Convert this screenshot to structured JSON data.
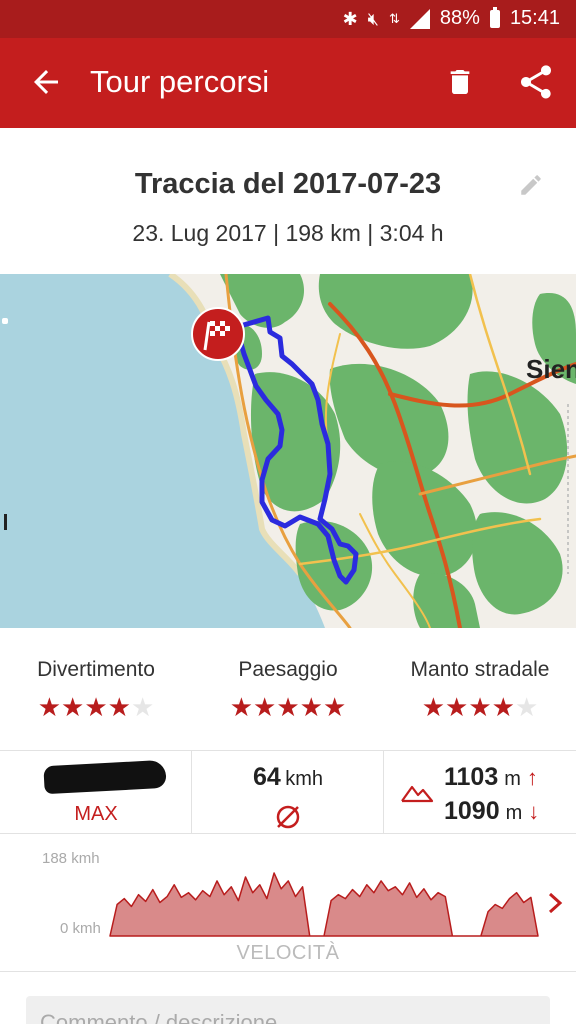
{
  "status_bar": {
    "battery": "88%",
    "time": "15:41",
    "icons": [
      "bluetooth-icon",
      "mute-icon",
      "data-icon",
      "signal-icon",
      "battery-icon"
    ]
  },
  "app_bar": {
    "title": "Tour percorsi",
    "icons": [
      "back-arrow-icon",
      "trash-icon",
      "share-icon"
    ]
  },
  "track": {
    "name": "Traccia del 2017-07-23",
    "summary": "23. Lug 2017 | 198 km | 3:04 h"
  },
  "map": {
    "city_label": "Sien"
  },
  "ratings": [
    {
      "label": "Divertimento",
      "stars": 4,
      "max": 5
    },
    {
      "label": "Paesaggio",
      "stars": 5,
      "max": 5
    },
    {
      "label": "Manto stradale",
      "stars": 4,
      "max": 5
    }
  ],
  "stats": {
    "max_label": "MAX",
    "avg_value": "64",
    "avg_unit": "kmh",
    "ascent_value": "1103",
    "descent_value": "1090",
    "elevation_unit": "m",
    "up_arrow": "↑",
    "down_arrow": "↓"
  },
  "speed_chart": {
    "y_max_label": "188 kmh",
    "y_min_label": "0 kmh",
    "x_label": "VELOCITÀ"
  },
  "chart_data": {
    "type": "area",
    "ylim": [
      0,
      188
    ],
    "series": [
      {
        "values": [
          0,
          80,
          95,
          75,
          105,
          88,
          118,
          85,
          100,
          130,
          98,
          110,
          92,
          115,
          100,
          140,
          105,
          125,
          90,
          150,
          110,
          130,
          95,
          160,
          120,
          140,
          100,
          125,
          0,
          0,
          0,
          90,
          105,
          95,
          118,
          100,
          130,
          110,
          140,
          115,
          125,
          105,
          135,
          98,
          120,
          92,
          110,
          100,
          0,
          0,
          0,
          0,
          0,
          62,
          80,
          70,
          95,
          110,
          85,
          98,
          0
        ]
      }
    ],
    "colors": {
      "fill": "#d98a8a",
      "line": "#b81d1d"
    }
  },
  "comment": {
    "placeholder": "Commento / descrizione"
  },
  "colors": {
    "brand_red": "#c41e1e",
    "status_red": "#a81c1c",
    "route_blue": "#2b2bde",
    "forest_green": "#6bb56b",
    "sea_blue": "#aad3df"
  }
}
